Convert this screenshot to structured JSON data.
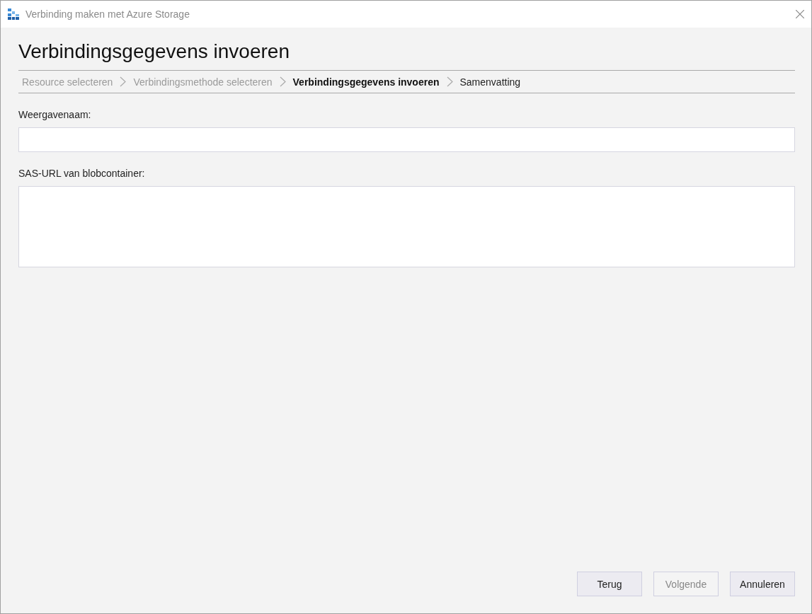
{
  "window": {
    "title": "Verbinding maken met Azure Storage"
  },
  "heading": "Verbindingsgegevens invoeren",
  "steps": [
    {
      "label": "Resource selecteren",
      "completed": true,
      "selected": false
    },
    {
      "label": "Verbindingsmethode selecteren",
      "completed": true,
      "selected": false
    },
    {
      "label": "Verbindingsgegevens invoeren",
      "completed": false,
      "selected": true
    },
    {
      "label": "Samenvatting",
      "completed": false,
      "selected": false
    }
  ],
  "fields": [
    {
      "label": "Weergavenaam:",
      "kind": "line"
    },
    {
      "label": "SAS-URL van blobcontainer:",
      "kind": "area"
    }
  ],
  "buttons": [
    {
      "label": "Terug",
      "disabled": false
    },
    {
      "label": "Volgende",
      "disabled": true
    },
    {
      "label": "Annuleren",
      "disabled": false
    }
  ]
}
